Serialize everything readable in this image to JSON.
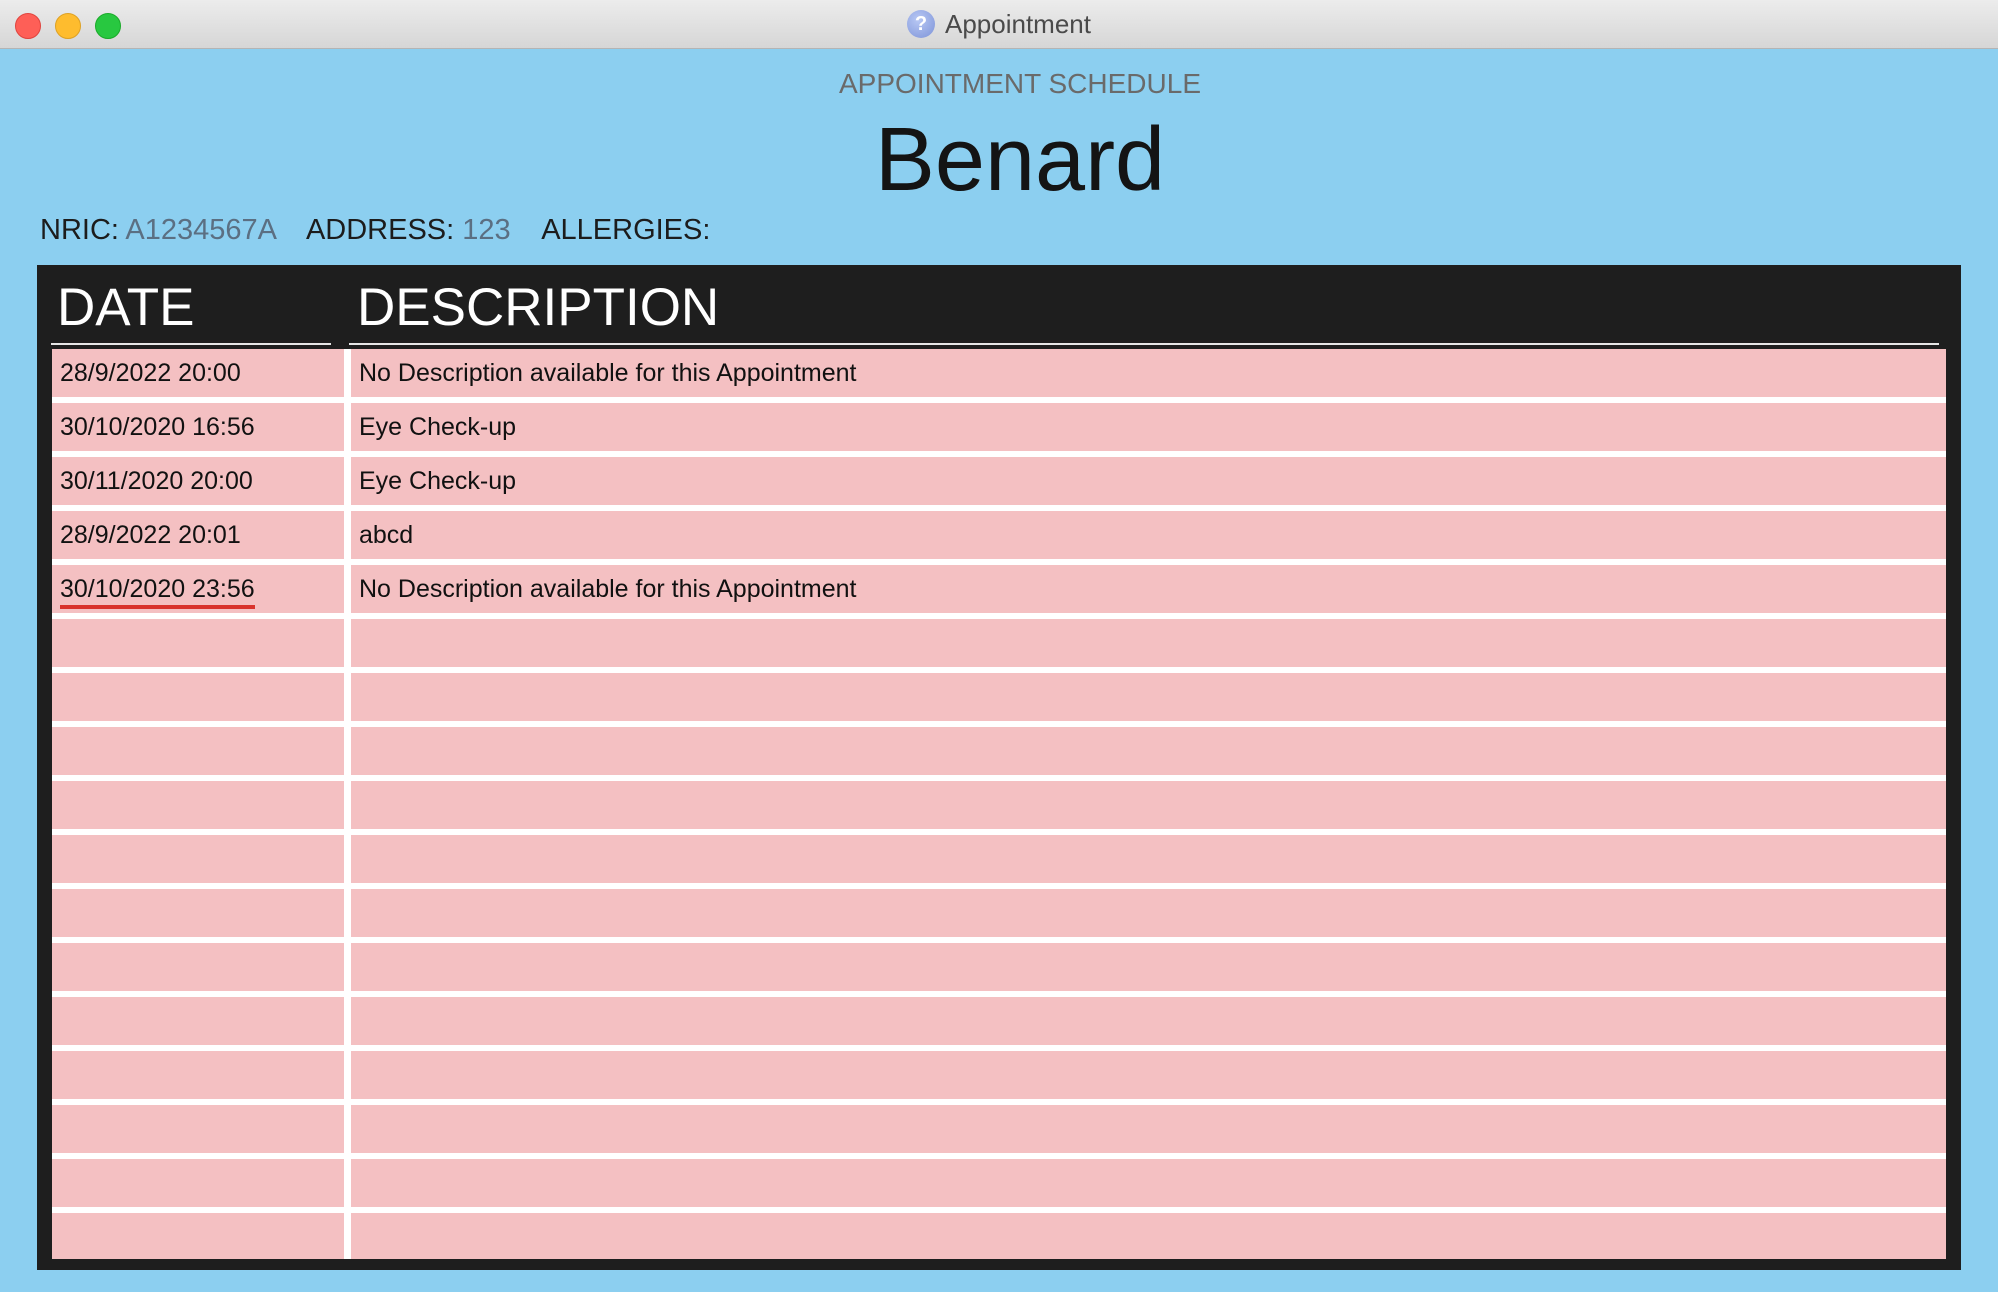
{
  "window": {
    "title": "Appointment",
    "icon_glyph": "?",
    "icon": "help-question-icon"
  },
  "header": {
    "subtitle": "APPOINTMENT SCHEDULE",
    "patient_name": "Benard"
  },
  "info": {
    "nric_label": "NRIC:",
    "nric_value": "A1234567A",
    "address_label": "ADDRESS:",
    "address_value": "123",
    "allergies_label": "ALLERGIES:",
    "allergies_value": ""
  },
  "table": {
    "columns": [
      "DATE",
      "DESCRIPTION"
    ],
    "rows": [
      {
        "date": "28/9/2022 20:00",
        "description": "No Description available for this Appointment"
      },
      {
        "date": "30/10/2020 16:56",
        "description": "Eye Check-up"
      },
      {
        "date": "30/11/2020 20:00",
        "description": "Eye Check-up"
      },
      {
        "date": "28/9/2022 20:01",
        "description": "abcd"
      },
      {
        "date": "30/10/2020 23:56",
        "description": "No Description available for this Appointment",
        "spellcheck_underline": true
      }
    ],
    "empty_rows": 12
  },
  "colors": {
    "background": "#8ccff0",
    "table_panel": "#1e1e1e",
    "row_fill": "#f4c0c2",
    "accent_value": "#5b6f82"
  }
}
